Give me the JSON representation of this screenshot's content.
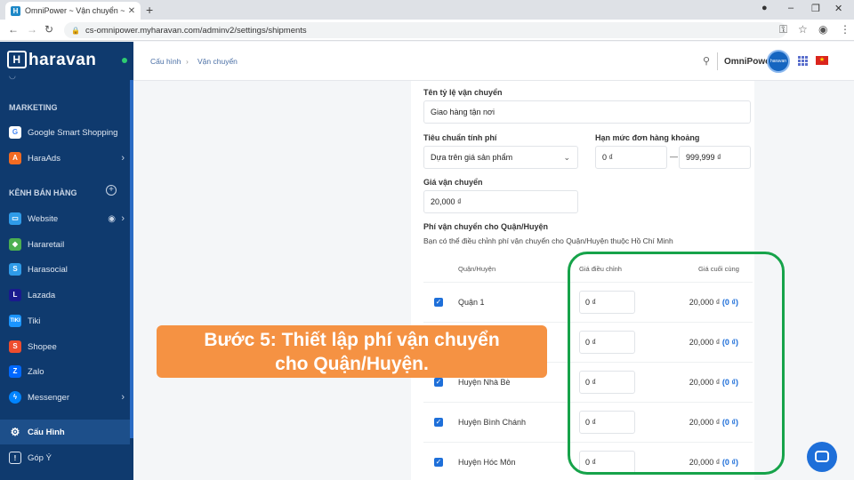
{
  "browser": {
    "tab_title": "OmniPower ~ Vận chuyển ~ Har",
    "favicon_letter": "H",
    "url": "cs-omnipower.myharavan.com/adminv2/settings/shipments"
  },
  "sidebar": {
    "logo_text": "haravan",
    "sections": [
      {
        "heading": "MARKETING"
      },
      {
        "heading": "KÊNH BÁN HÀNG"
      }
    ],
    "items": [
      {
        "label": "Google Smart Shopping",
        "icon": "google-icon",
        "color": "#ffffff"
      },
      {
        "label": "HaraAds",
        "icon": "haraads-icon",
        "color": "#f26b22"
      },
      {
        "label": "Website",
        "icon": "website-icon",
        "color": "#2f9be8"
      },
      {
        "label": "Hararetail",
        "icon": "hararetail-icon",
        "color": "#4caf50"
      },
      {
        "label": "Harasocial",
        "icon": "harasocial-icon",
        "color": "#2f9be8"
      },
      {
        "label": "Lazada",
        "icon": "lazada-icon",
        "color": "#1a1a8e"
      },
      {
        "label": "Tiki",
        "icon": "tiki-icon",
        "color": "#1a94ff"
      },
      {
        "label": "Shopee",
        "icon": "shopee-icon",
        "color": "#ee4d2d"
      },
      {
        "label": "Zalo",
        "icon": "zalo-icon",
        "color": "#0068ff"
      },
      {
        "label": "Messenger",
        "icon": "messenger-icon",
        "color": "#0084ff"
      },
      {
        "label": "Cấu Hình",
        "icon": "gear-icon",
        "color": "#ffffff"
      },
      {
        "label": "Góp Ý",
        "icon": "feedback-icon",
        "color": "#ffffff"
      }
    ]
  },
  "header": {
    "breadcrumb": [
      "Cấu hình",
      "Vận chuyển"
    ],
    "shop_name": "OmniPower",
    "avatar_text": "haravan"
  },
  "form": {
    "rate_name_label": "Tên tỷ lệ vận chuyển",
    "rate_name_value": "Giao hàng tận nơi",
    "criteria_label": "Tiêu chuẩn tính phí",
    "criteria_value": "Dựa trên giá sản phẩm",
    "range_label": "Hạn mức đơn hàng khoảng",
    "range_min": "0 ₫",
    "range_sep": "—",
    "range_max": "999,999 ₫",
    "price_label": "Giá vận chuyển",
    "price_value": "20,000 ₫",
    "district_section_title": "Phí vận chuyển cho Quận/Huyện",
    "district_section_desc": "Bạn có thể điều chỉnh phí vận chuyển cho Quận/Huyện thuộc Hồ Chí Minh"
  },
  "table": {
    "col_district": "Quận/Huyện",
    "col_adjust": "Giá điều chỉnh",
    "col_final": "Giá cuối cùng",
    "rows": [
      {
        "name": "Quận 1",
        "adjust": "0 ₫",
        "final": "20,000 ₫",
        "final_adj": "(0 ₫)"
      },
      {
        "name": "",
        "adjust": "0 ₫",
        "final": "20,000 ₫",
        "final_adj": "(0 ₫)"
      },
      {
        "name": "Huyện Nhà Bè",
        "adjust": "0 ₫",
        "final": "20,000 ₫",
        "final_adj": "(0 ₫)"
      },
      {
        "name": "Huyện Bình Chánh",
        "adjust": "0 ₫",
        "final": "20,000 ₫",
        "final_adj": "(0 ₫)"
      },
      {
        "name": "Huyện Hóc Môn",
        "adjust": "0 ₫",
        "final": "20,000 ₫",
        "final_adj": "(0 ₫)"
      }
    ]
  },
  "overlay": {
    "line1": "Bước 5: Thiết lập phí vận chuyển",
    "line2": "cho Quận/Huyện.",
    "callout_color": "#f59243",
    "ring_color": "#16a34a"
  }
}
